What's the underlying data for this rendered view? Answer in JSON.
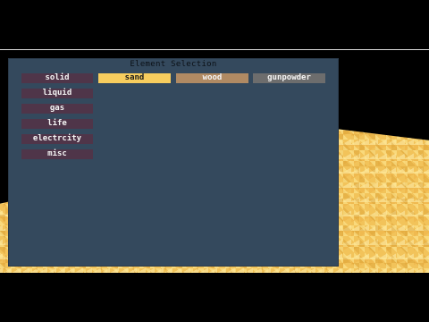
{
  "panel": {
    "title": "Element Selection",
    "categories": [
      "solid",
      "liquid",
      "gas",
      "life",
      "electrcity",
      "misc"
    ],
    "elements": [
      {
        "label": "sand",
        "color": "#f7cd5e",
        "text_color": "#1a1a1a"
      },
      {
        "label": "wood",
        "color": "#b08a63",
        "text_color": "#f4f4f4"
      },
      {
        "label": "gunpowder",
        "color": "#6d6d6d",
        "text_color": "#f4f4f4"
      }
    ]
  },
  "colors": {
    "panel_bg": "#34495d",
    "category_bg": "#4f3549",
    "sand_floor": "#f2c35a"
  }
}
